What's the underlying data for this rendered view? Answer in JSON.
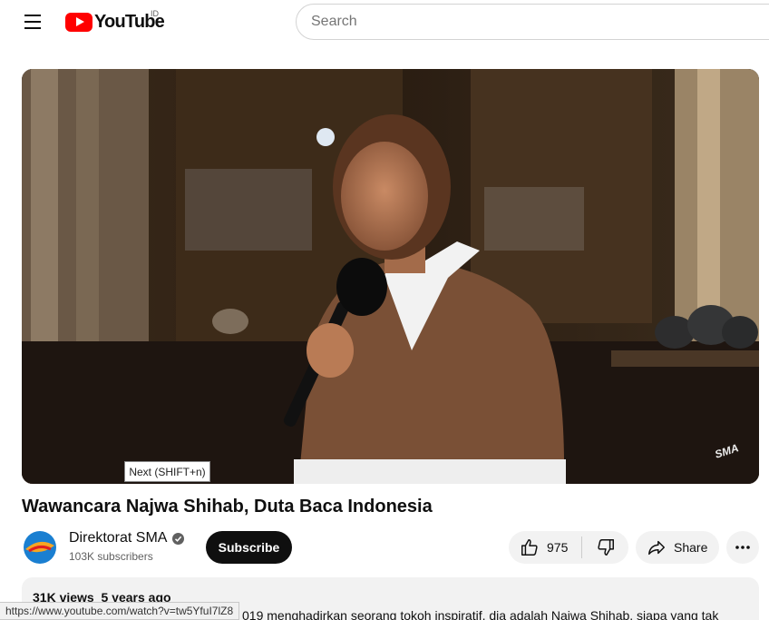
{
  "header": {
    "logo_text": "YouTube",
    "country_code": "ID",
    "search_placeholder": "Search"
  },
  "player": {
    "tooltip": "Next (SHIFT+n)",
    "watermark": "SMA"
  },
  "video": {
    "title": "Wawancara Najwa Shihab, Duta Baca Indonesia"
  },
  "channel": {
    "name": "Direktorat SMA",
    "subscribers": "103K subscribers",
    "subscribe_label": "Subscribe"
  },
  "actions": {
    "like_count": "975",
    "share_label": "Share"
  },
  "description": {
    "views": "31K views",
    "age": "5 years ago",
    "text": "019 menghadirkan seorang tokoh inspiratif, dia adalah Najwa Shihab, siapa yang tak"
  },
  "status_url": "https://www.youtube.com/watch?v=tw5YfuI7lZ8",
  "colors": {
    "brand_red": "#ff0000",
    "subscribe_bg": "#0f0f0f",
    "pill_bg": "#f2f2f2"
  }
}
